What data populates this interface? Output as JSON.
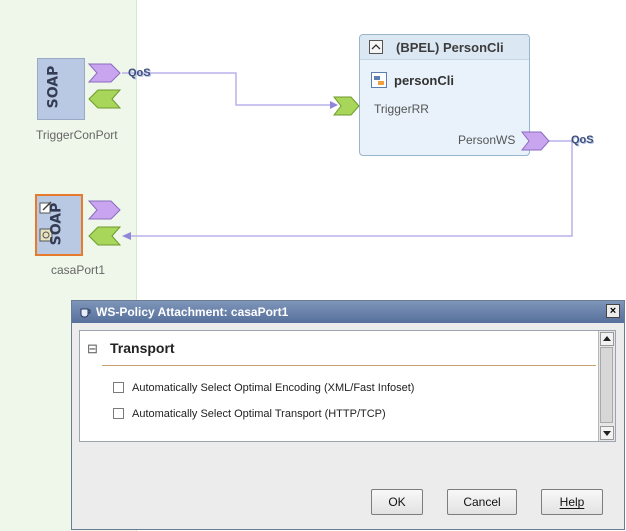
{
  "diagram": {
    "ports": [
      {
        "name": "TriggerConPort",
        "binding": "SOAP",
        "qos": "QoS"
      },
      {
        "name": "casaPort1",
        "binding": "SOAP"
      }
    ],
    "bpel_module": {
      "title": "(BPEL) PersonCli",
      "process": "personCli",
      "partner_link_in": "TriggerRR",
      "partner_link_out": "PersonWS",
      "out_qos": "QoS"
    }
  },
  "dialog": {
    "title": "WS-Policy Attachment: casaPort1",
    "close_symbol": "×",
    "section": {
      "collapse_symbol": "⊟",
      "title": "Transport",
      "options": [
        {
          "label": "Automatically Select Optimal Encoding (XML/Fast Infoset)",
          "checked": false
        },
        {
          "label": "Automatically Select Optimal Transport (HTTP/TCP)",
          "checked": false
        }
      ]
    },
    "buttons": {
      "ok": "OK",
      "cancel": "Cancel",
      "help": "Help"
    }
  },
  "colors": {
    "soap_box": "#b9c9e4",
    "selected_border": "#e77a2c",
    "connector": "#b9b2ea",
    "provide_arrow": "#c9a5f0",
    "consume_arrow": "#a7d65a",
    "title_bar": "#6881ad"
  }
}
